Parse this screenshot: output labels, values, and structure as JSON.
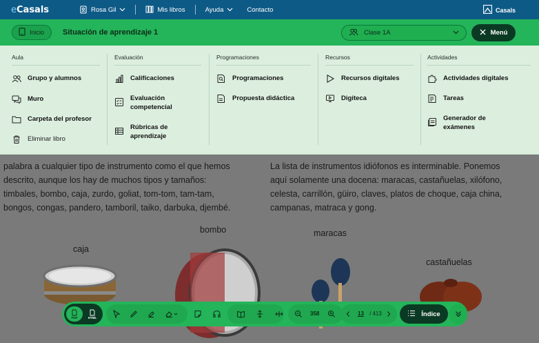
{
  "topbar": {
    "logo": "Casals",
    "logo_e": "e",
    "user": "Rosa Gil",
    "my_books": "Mis libros",
    "help": "Ayuda",
    "contact": "Contacto",
    "brand": "Casals"
  },
  "greenbar": {
    "home": "Inicio",
    "title": "Situación de aprendizaje 1",
    "class_select": "Clase 1A",
    "menu": "Menú"
  },
  "menu": {
    "aula": {
      "heading": "Aula",
      "items": [
        "Grupo y alumnos",
        "Muro",
        "Carpeta del profesor",
        "Eliminar libro"
      ]
    },
    "evaluacion": {
      "heading": "Evaluación",
      "items": [
        "Calificaciones",
        "Evaluación competencial",
        "Rúbricas de aprendizaje"
      ]
    },
    "programaciones": {
      "heading": "Programaciones",
      "items": [
        "Programaciones",
        "Propuesta didáctica"
      ]
    },
    "recursos": {
      "heading": "Recursos",
      "items": [
        "Recursos digitales",
        "Digiteca"
      ]
    },
    "actividades": {
      "heading": "Actividades",
      "items": [
        "Actividades digitales",
        "Tareas",
        "Generador de exámenes"
      ]
    }
  },
  "page": {
    "left_lines": [
      "palabra a cualquier tipo de instrumento como el que hemos",
      "descrito, aunque los hay de muchos tipos y tamaños:",
      "timbales, bombo, caja, zurdo, goliat, tom-tom, tam-tam,",
      "bongos, congas, pandero, tamboril, taiko, darbuka, djembé."
    ],
    "right_lines": [
      "La lista de instrumentos idiófonos es interminable. Ponemos",
      "aquí solamente una docena: maracas, castañuelas, xilófono,",
      "celesta, carrillón, güiro, claves, platos de choque, caja china,",
      "campanas, matraca y gong."
    ],
    "labels": {
      "caja": "caja",
      "bombo": "bombo",
      "maracas": "maracas",
      "castanuelas": "castañuelas"
    }
  },
  "toolbar": {
    "pdf": "PDF",
    "html": "HTML",
    "zoom": "358",
    "current_page": "13",
    "total_pages": "/ 413",
    "index": "Índice"
  },
  "colors": {
    "topbar": "#0e5a86",
    "green": "#24b45a",
    "dark_green": "#0b3a24",
    "menu_bg": "#dcefdf"
  }
}
